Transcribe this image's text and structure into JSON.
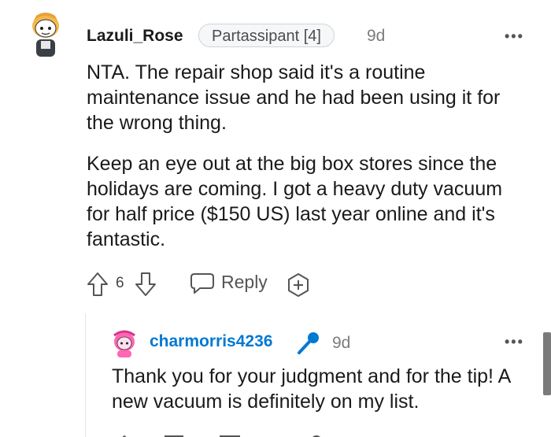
{
  "comment": {
    "username": "Lazuli_Rose",
    "flair": "Partassipant [4]",
    "time": "9d",
    "more": "•••",
    "paragraphs": [
      "NTA. The repair shop said it's a routine maintenance issue and he had been using it for the wrong thing.",
      "Keep an eye out at the big box stores since the holidays are coming. I got a heavy duty vacuum for half price ($150 US) last year online and it's fantastic."
    ],
    "vote_count": "6",
    "reply_label": "Reply"
  },
  "reply": {
    "username": "charmorris4236",
    "time": "9d",
    "more": "•••",
    "text": "Thank you for your judgment and for the tip! A new vacuum is definitely on my list."
  },
  "icons": {
    "upvote": "arrow-up-outline-icon",
    "downvote": "arrow-down-outline-icon",
    "reply": "speech-bubble-icon",
    "award": "plus-circle-icon",
    "op_badge": "microphone-icon"
  },
  "colors": {
    "username": "#1a1a1b",
    "reply_username": "#0079d3",
    "mic_badge": "#0079d3",
    "meta": "#7c7c7c"
  }
}
